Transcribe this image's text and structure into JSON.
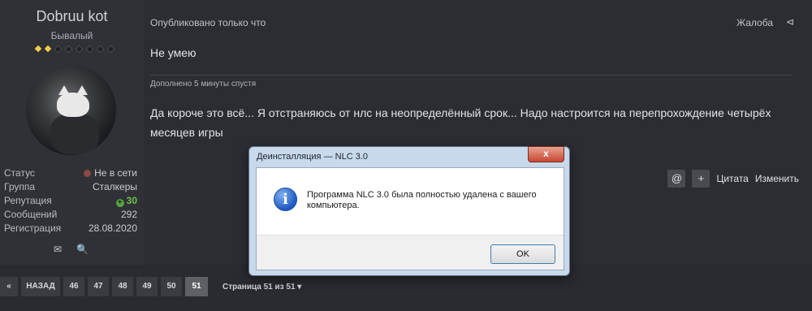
{
  "user": {
    "name": "Dobruu kot",
    "title": "Бывалый",
    "rank_filled": 2,
    "rank_total": 8,
    "stats": [
      {
        "key": "Статус",
        "value": "Не в сети"
      },
      {
        "key": "Группа",
        "value": "Сталкеры"
      },
      {
        "key": "Репутация",
        "value": "30"
      },
      {
        "key": "Сообщений",
        "value": "292"
      },
      {
        "key": "Регистрация",
        "value": "28.08.2020"
      }
    ],
    "icons": [
      "mail-icon",
      "search-icon"
    ]
  },
  "post": {
    "meta": "Опубликовано только что",
    "report": "Жалоба",
    "first_line": "Не умею",
    "addon": "Дополнено 5 минуты спустя",
    "text": "Да короче это всё... Я отстраняюсь от нлс на неопределённый срок... Надо настроится на перепрохождение четырёх месяцев игры",
    "actions": {
      "mention": "@",
      "add": "+",
      "quote": "Цитата",
      "edit": "Изменить"
    }
  },
  "pagination": {
    "prev": "НАЗАД",
    "pages": [
      "46",
      "47",
      "48",
      "49",
      "50",
      "51"
    ],
    "current": "51",
    "info": "Страница 51 из 51"
  },
  "dialog": {
    "title": "Деинсталляция — NLC 3.0",
    "message": "Программа NLC 3.0 была полностью удалена с вашего компьютера.",
    "ok": "OK",
    "close": "x"
  },
  "colors": {
    "background": "#2a2b30",
    "accent_rank": "#f2cf4a",
    "reputation": "#6fbf4e",
    "dialog_frame": "#c8d9ec"
  }
}
